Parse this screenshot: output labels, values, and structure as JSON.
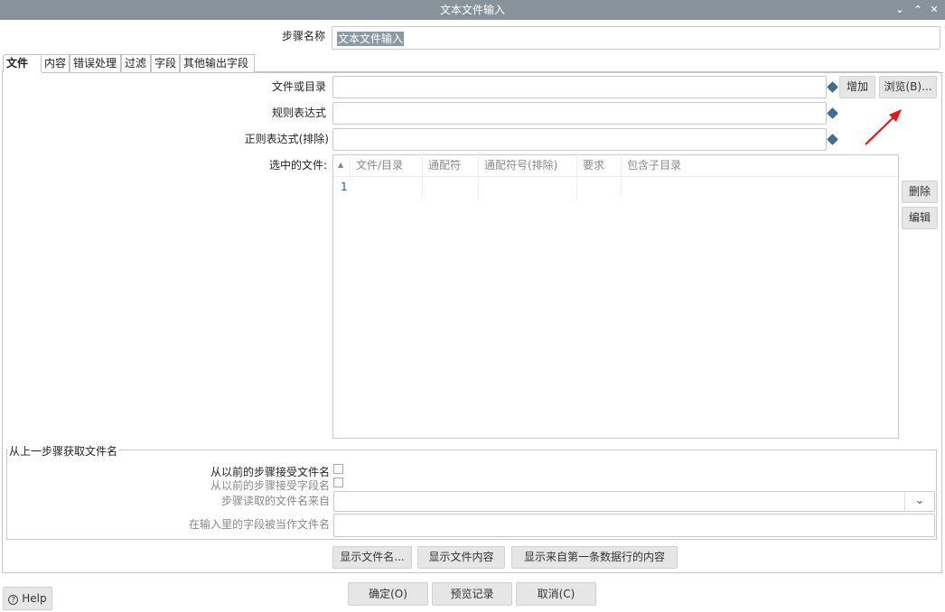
{
  "window": {
    "title": "文本文件输入",
    "controls": [
      "⌄",
      "⌃",
      "✕"
    ]
  },
  "step_name": {
    "label": "步骤名称",
    "value": "文本文件输入"
  },
  "tabs": [
    {
      "label": "文件"
    },
    {
      "label": "内容"
    },
    {
      "label": "错误处理"
    },
    {
      "label": "过滤"
    },
    {
      "label": "字段"
    },
    {
      "label": "其他输出字段"
    }
  ],
  "file_tab": {
    "file_or_dir_label": "文件或目录",
    "file_or_dir_value": "",
    "regex_label": "规则表达式",
    "regex_value": "",
    "regex_exclude_label": "正则表达式(排除)",
    "regex_exclude_value": "",
    "add_button": "增加",
    "browse_button": "浏览(B)...",
    "selected_files_label": "选中的文件:",
    "table": {
      "columns": [
        "文件/目录",
        "通配符",
        "通配符号(排除)",
        "要求",
        "包含子目录"
      ],
      "rows": [
        {
          "index": "1",
          "cells": [
            "",
            "",
            "",
            "",
            ""
          ]
        }
      ]
    },
    "delete_button": "删除",
    "edit_button": "编辑",
    "group": {
      "title": "从上一步骤获取文件名",
      "accept_filenames_label": "从以前的步骤接受文件名",
      "accept_filenames_checked": false,
      "accept_fieldnames_label": "从以前的步骤接受字段名",
      "accept_fieldnames_checked": false,
      "step_source_label": "步骤读取的文件名来自",
      "step_source_value": "",
      "field_label": "在输入里的字段被当作文件名",
      "field_value": ""
    },
    "show_filenames_button": "显示文件名...",
    "show_content_button": "显示文件内容",
    "show_first_row_button": "显示来自第一条数据行的内容"
  },
  "footer": {
    "help": "Help",
    "ok": "确定(O)",
    "preview": "预览记录",
    "cancel": "取消(C)"
  },
  "colors": {
    "titlebar": "#87929a",
    "annotation_arrow": "#e8141b",
    "variable_icon": "#3f6e8f"
  }
}
